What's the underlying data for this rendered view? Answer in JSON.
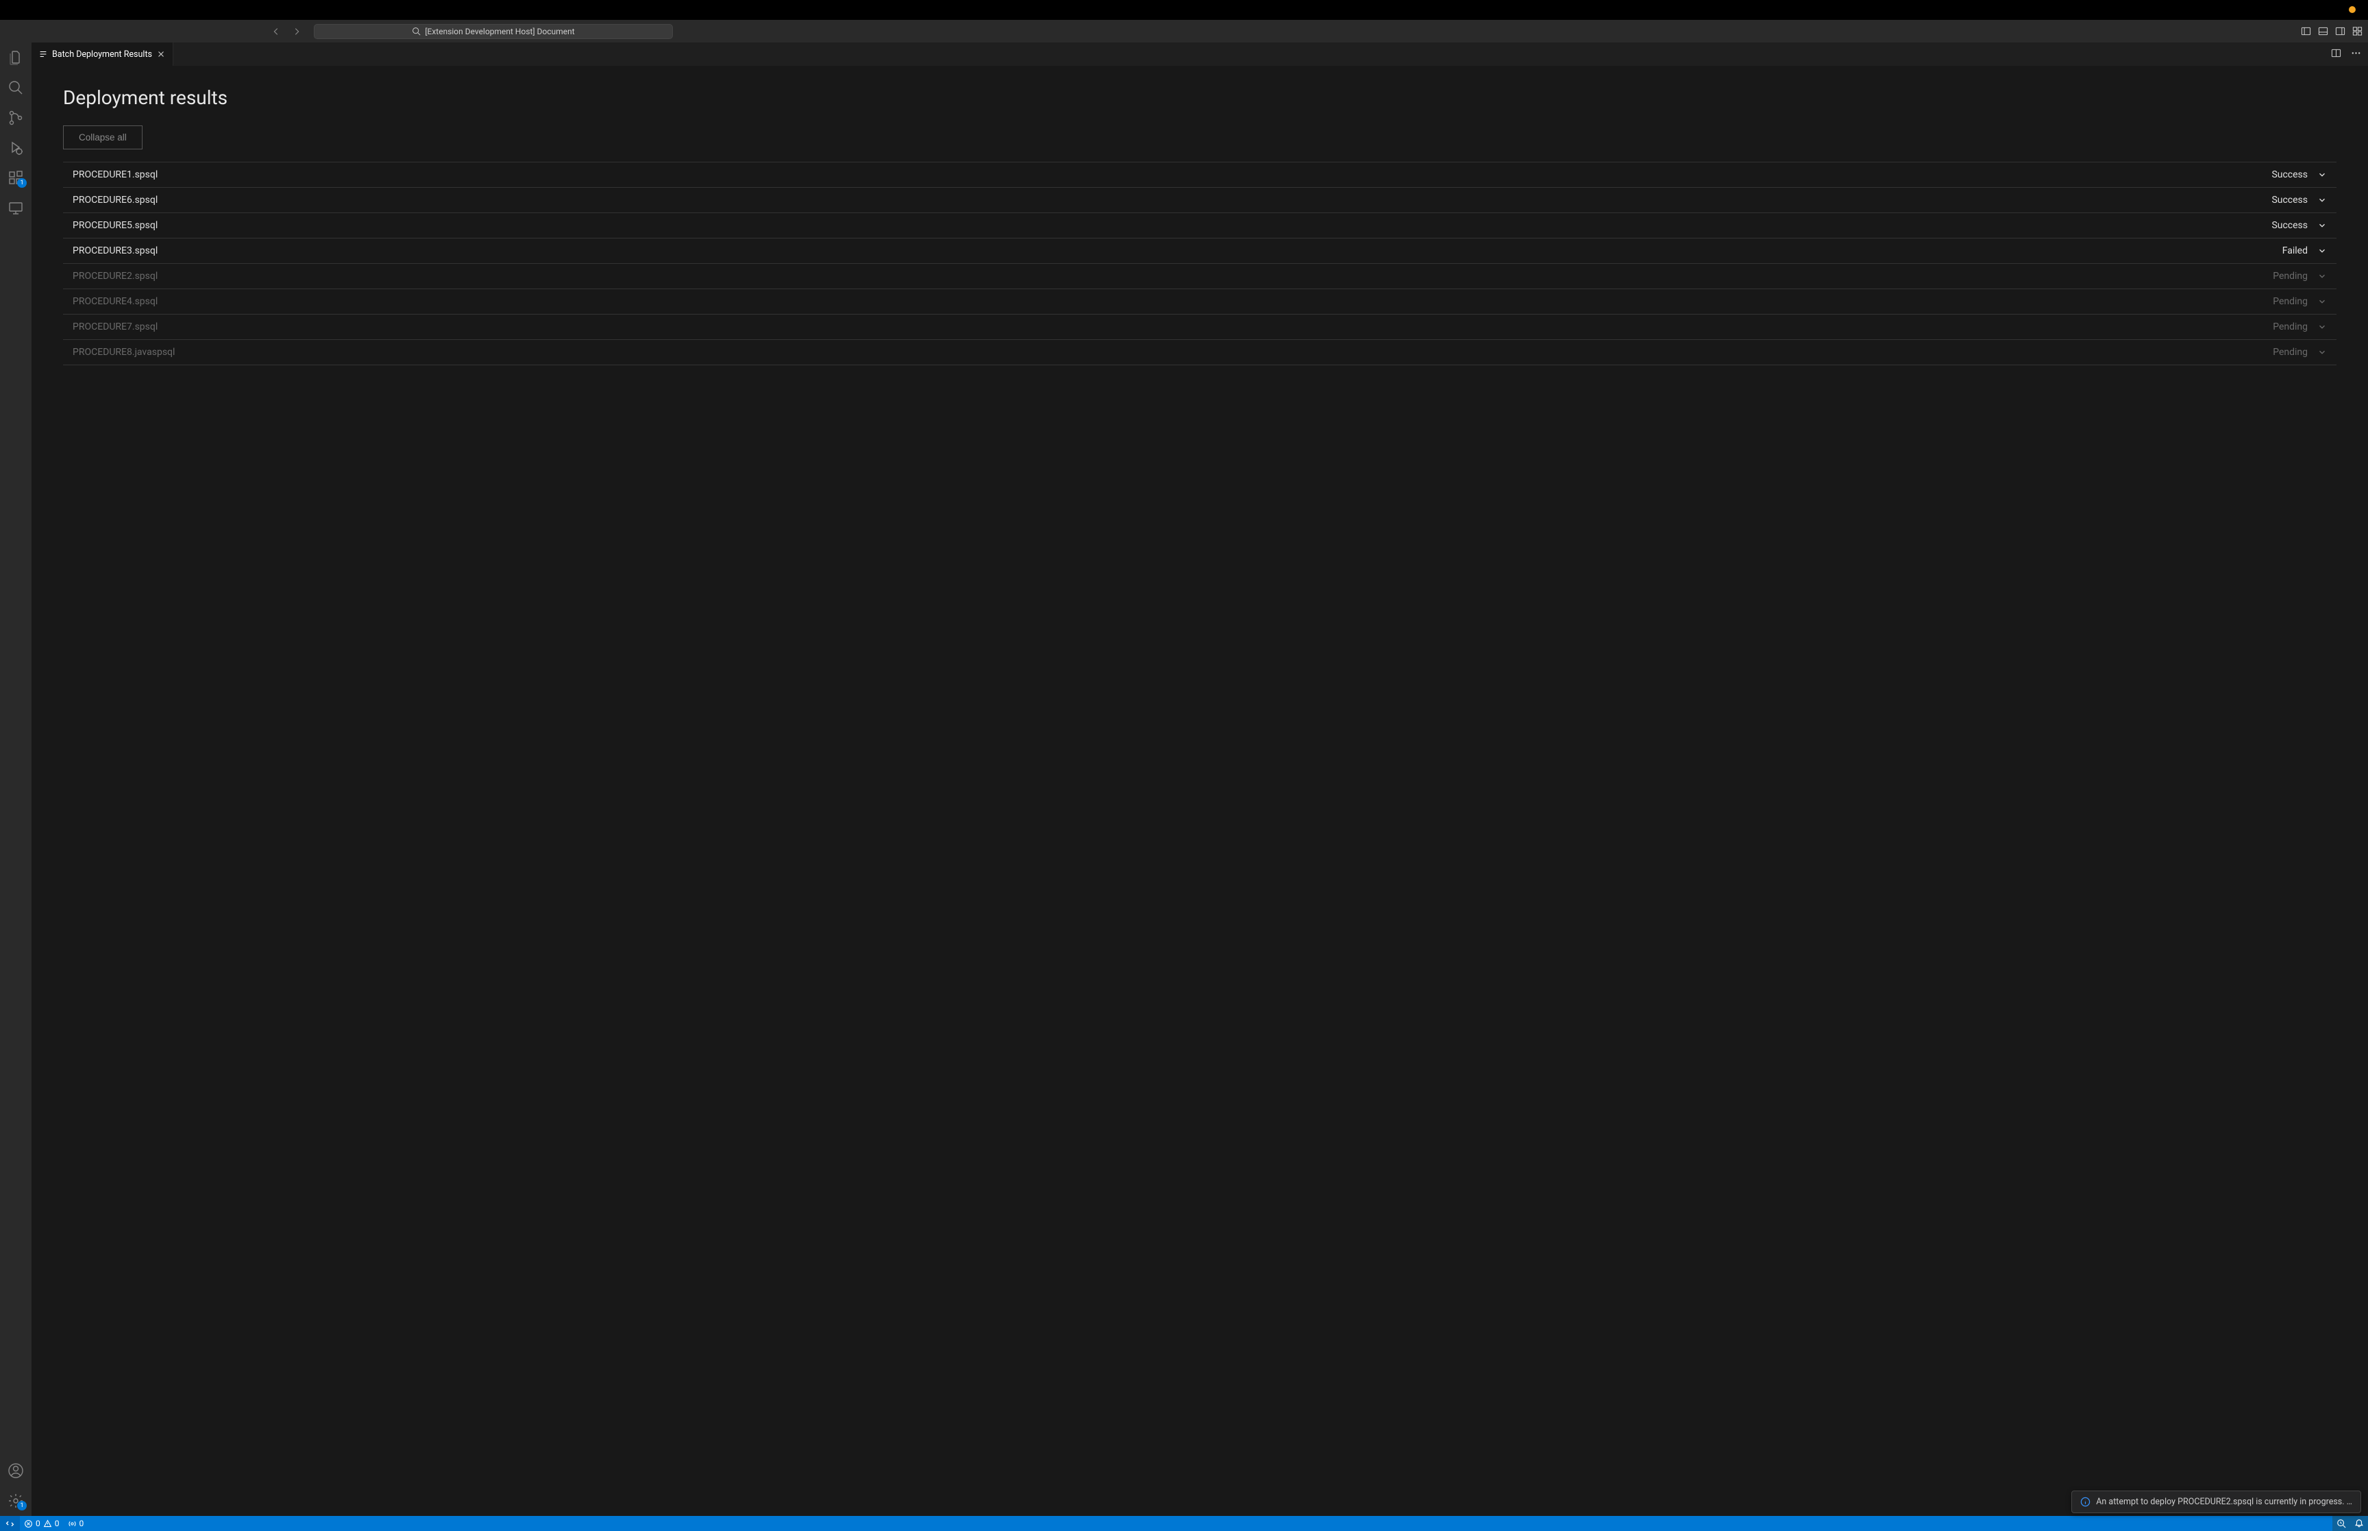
{
  "window": {
    "search_text": "[Extension Development Host] Document"
  },
  "tab": {
    "title": "Batch Deployment Results"
  },
  "activity_badges": {
    "extensions": "1",
    "settings": "1"
  },
  "page": {
    "title": "Deployment results",
    "collapse_label": "Collapse all"
  },
  "results": [
    {
      "name": "PROCEDURE1.spsql",
      "status": "Success",
      "pending": false
    },
    {
      "name": "PROCEDURE6.spsql",
      "status": "Success",
      "pending": false
    },
    {
      "name": "PROCEDURE5.spsql",
      "status": "Success",
      "pending": false
    },
    {
      "name": "PROCEDURE3.spsql",
      "status": "Failed",
      "pending": false
    },
    {
      "name": "PROCEDURE2.spsql",
      "status": "Pending",
      "pending": true
    },
    {
      "name": "PROCEDURE4.spsql",
      "status": "Pending",
      "pending": true
    },
    {
      "name": "PROCEDURE7.spsql",
      "status": "Pending",
      "pending": true
    },
    {
      "name": "PROCEDURE8.javaspsql",
      "status": "Pending",
      "pending": true
    }
  ],
  "status_bar": {
    "errors": "0",
    "warnings": "0",
    "ports": "0"
  },
  "toast": {
    "message": "An attempt to deploy PROCEDURE2.spsql is currently in progress. …"
  }
}
